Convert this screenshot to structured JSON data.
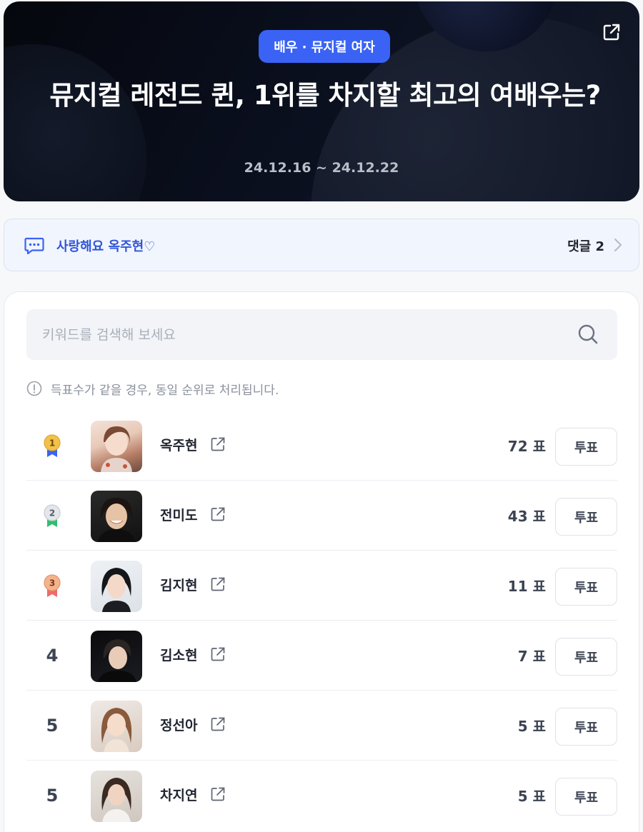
{
  "hero": {
    "category": "배우 · 뮤지컬 여자",
    "title": "뮤지컬 레전드 퀸, 1위를 차지할 최고의 여배우는?",
    "period": "24.12.16 ~ 24.12.22"
  },
  "comment_bar": {
    "message": "사랑해요 옥주현♡",
    "count_label": "댓글 2"
  },
  "search": {
    "placeholder": "키워드를 검색해 보세요",
    "value": ""
  },
  "notice": "득표수가 같을 경우, 동일 순위로 처리됩니다.",
  "vote_button_label": "투표",
  "candidates": [
    {
      "rank": "1",
      "medal": "gold",
      "name": "옥주현",
      "votes": "72 표"
    },
    {
      "rank": "2",
      "medal": "silver",
      "name": "전미도",
      "votes": "43 표"
    },
    {
      "rank": "3",
      "medal": "bronze",
      "name": "김지현",
      "votes": "11 표"
    },
    {
      "rank": "4",
      "medal": null,
      "name": "김소현",
      "votes": "7 표"
    },
    {
      "rank": "5",
      "medal": null,
      "name": "정선아",
      "votes": "5 표"
    },
    {
      "rank": "5",
      "medal": null,
      "name": "차지연",
      "votes": "5 표"
    }
  ],
  "colors": {
    "accent": "#3a63f5",
    "comment_text": "#3054d8",
    "medal_gold": "#f2c14b",
    "medal_silver": "#d9dde3",
    "medal_bronze": "#f0a67a"
  },
  "icons": {
    "share": "share-icon",
    "chat": "chat-bubble-icon",
    "chevron": "chevron-right-icon",
    "search": "search-icon",
    "info": "info-icon",
    "external": "external-link-icon"
  }
}
